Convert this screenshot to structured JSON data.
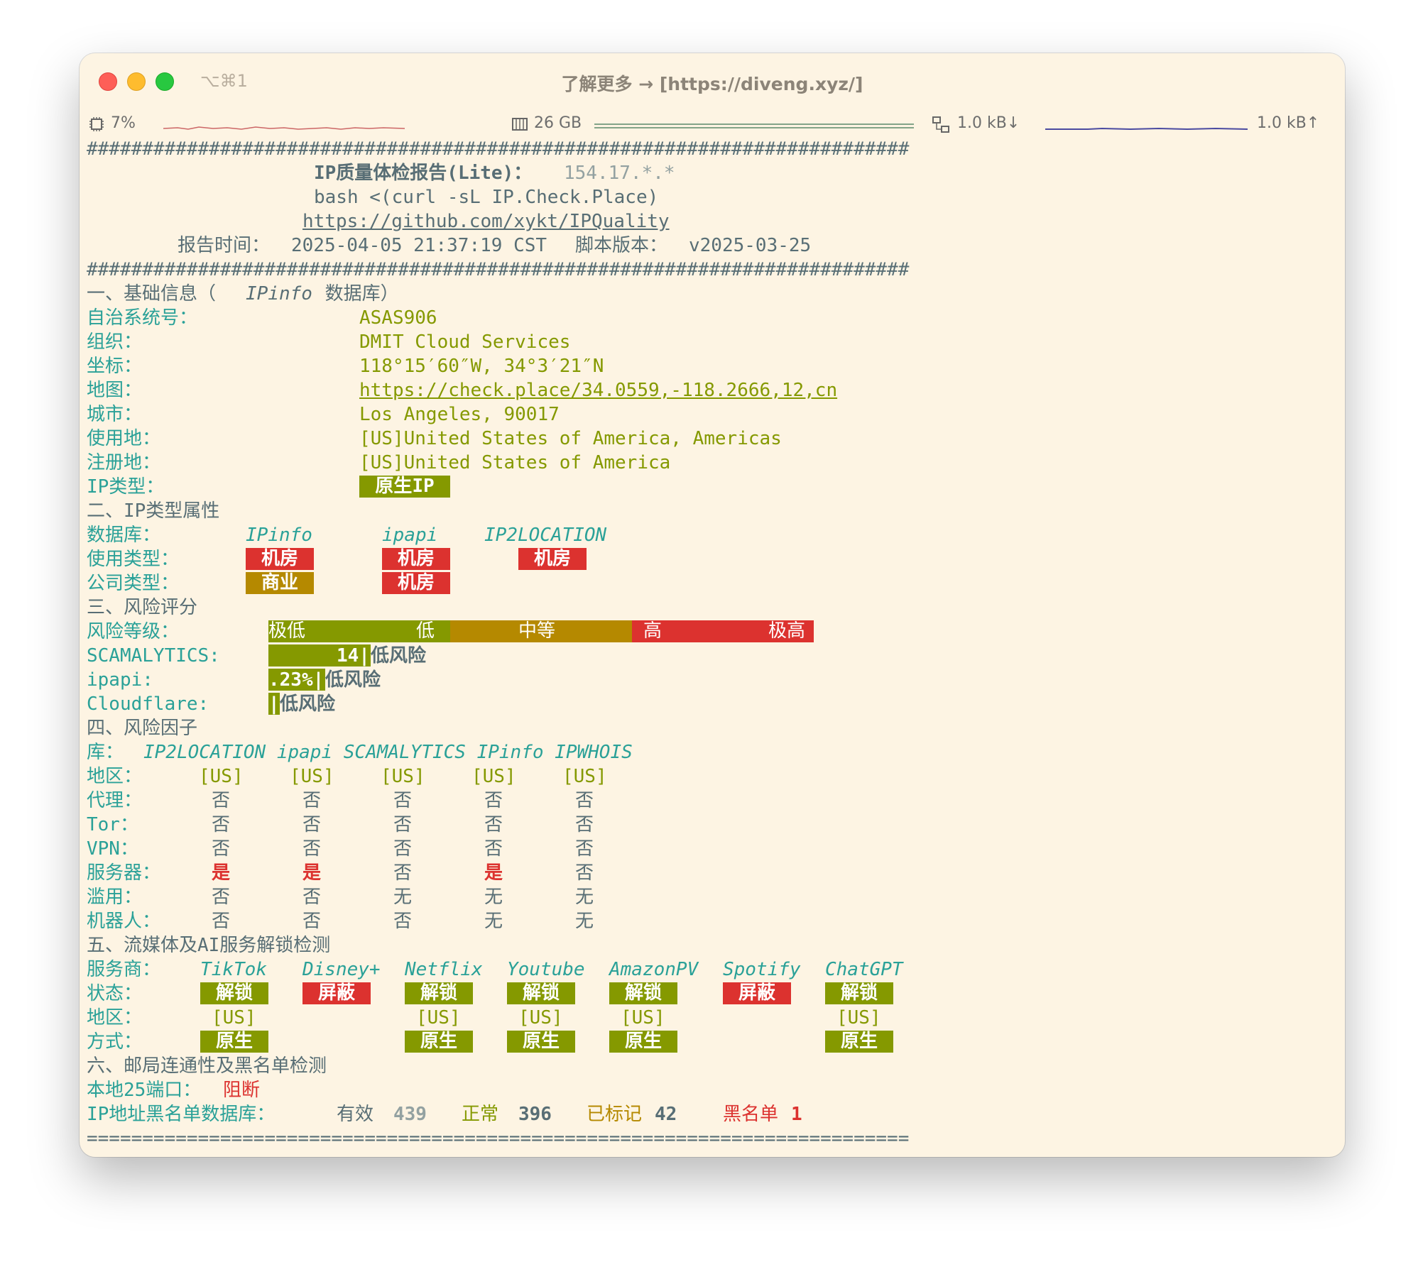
{
  "window": {
    "shortcut": "⌥⌘1",
    "title": "了解更多 → [https://diveng.xyz/]"
  },
  "status": {
    "cpu": "7%",
    "memory": "26 GB",
    "net_down": "1.0 kB↓",
    "net_up": "1.0 kB↑"
  },
  "header": {
    "hashes": "##########################################################################",
    "title": "IP质量体检报告(Lite)：",
    "ip": "154.17.*.*",
    "command": "bash <(curl -sL IP.Check.Place)",
    "repo": "https://github.com/xykt/IPQuality",
    "time_label": "报告时间：",
    "time": "2025-04-05 21:37:19 CST",
    "version_label": "脚本版本：",
    "version": "v2025-03-25"
  },
  "basic": {
    "heading": "一、基础信息（",
    "heading_db": "IPinfo",
    "heading_end": " 数据库）",
    "rows": [
      {
        "label": "自治系统号：",
        "value": "ASAS906"
      },
      {
        "label": "组织：",
        "value": "DMIT Cloud Services"
      },
      {
        "label": "坐标：",
        "value": "118°15′60″W, 34°3′21″N"
      },
      {
        "label": "地图：",
        "value": "https://check.place/34.0559,-118.2666,12,cn"
      },
      {
        "label": "城市：",
        "value": "Los Angeles, 90017"
      },
      {
        "label": "使用地：",
        "value": "[US]United States of America, Americas"
      },
      {
        "label": "注册地：",
        "value": "[US]United States of America"
      }
    ],
    "ip_type_label": "IP类型：",
    "ip_type": "原生IP"
  },
  "types": {
    "heading": "二、IP类型属性",
    "db_label": "数据库：",
    "dbs": [
      "IPinfo",
      "ipapi",
      "IP2LOCATION"
    ],
    "usage_label": "使用类型：",
    "usage": [
      "机房",
      "机房",
      "机房"
    ],
    "company_label": "公司类型：",
    "company": [
      "商业",
      "机房"
    ]
  },
  "risk": {
    "heading": "三、风险评分",
    "level_label": "风险等级：",
    "levels": [
      "极低",
      "低",
      "中等",
      "高",
      "极高"
    ],
    "scamalytics_label": "SCAMALYTICS:",
    "scamalytics_value": "14|",
    "scamalytics_text": "低风险",
    "ipapi_label": "ipapi:",
    "ipapi_value": ".23%|",
    "ipapi_text": "低风险",
    "cloudflare_label": "Cloudflare:",
    "cloudflare_value": "|",
    "cloudflare_text": "低风险"
  },
  "factors": {
    "heading": "四、风险因子",
    "db_label": "库：",
    "dbs": "IP2LOCATION ipapi SCAMALYTICS IPinfo IPWHOIS",
    "rows": [
      {
        "label": "地区：",
        "values": [
          "[US]",
          "[US]",
          "[US]",
          "[US]",
          "[US]"
        ]
      },
      {
        "label": "代理：",
        "values": [
          "否",
          "否",
          "否",
          "否",
          "否"
        ]
      },
      {
        "label": "Tor：",
        "values": [
          "否",
          "否",
          "否",
          "否",
          "否"
        ]
      },
      {
        "label": "VPN：",
        "values": [
          "否",
          "否",
          "否",
          "否",
          "否"
        ]
      },
      {
        "label": "服务器：",
        "values": [
          "是",
          "是",
          "否",
          "是",
          "否"
        ]
      },
      {
        "label": "滥用：",
        "values": [
          "否",
          "否",
          "无",
          "无",
          "无"
        ]
      },
      {
        "label": "机器人：",
        "values": [
          "否",
          "否",
          "否",
          "无",
          "无"
        ]
      }
    ]
  },
  "media": {
    "heading": "五、流媒体及AI服务解锁检测",
    "service_label": "服务商：",
    "services": [
      "TikTok",
      "Disney+",
      "Netflix",
      "Youtube",
      "AmazonPV",
      "Spotify",
      "ChatGPT"
    ],
    "status_label": "状态：",
    "status": [
      "解锁",
      "屏蔽",
      "解锁",
      "解锁",
      "解锁",
      "屏蔽",
      "解锁"
    ],
    "region_label": "地区：",
    "regions": [
      "[US]",
      "",
      "[US]",
      "[US]",
      "[US]",
      "",
      "[US]"
    ],
    "method_label": "方式：",
    "methods": [
      "原生",
      "",
      "原生",
      "原生",
      "原生",
      "",
      "原生"
    ]
  },
  "mail": {
    "heading": "六、邮局连通性及黑名单检测",
    "port_label": "本地25端口：",
    "port_value": "阻断",
    "blacklist_label": "IP地址黑名单数据库：",
    "valid_label": "有效",
    "valid": "439",
    "normal_label": "正常",
    "normal": "396",
    "marked_label": "已标记",
    "marked": "42",
    "black_label": "黑名单",
    "black": "1"
  },
  "footer": {
    "rule": "=========================================================================="
  },
  "colors": {
    "green": "#859900",
    "red": "#dc322f",
    "orange": "#b58900",
    "cyan": "#2aa198",
    "background": "#fdf4e3"
  }
}
